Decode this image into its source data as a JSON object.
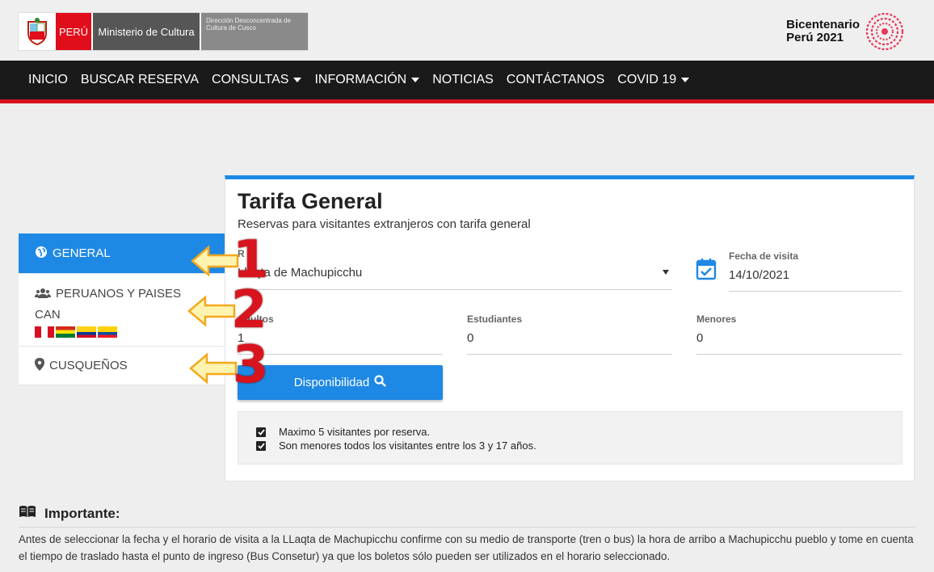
{
  "header": {
    "logo_peru": "PERÚ",
    "logo_ministerio": "Ministerio de Cultura",
    "logo_direccion": "Dirección Desconcentrada de Cultura de Cusco",
    "bicentenario_line1": "Bicentenario",
    "bicentenario_line2": "Perú 2021"
  },
  "nav": {
    "items": [
      {
        "label": "INICIO",
        "dropdown": false
      },
      {
        "label": "BUSCAR RESERVA",
        "dropdown": false
      },
      {
        "label": "CONSULTAS",
        "dropdown": true
      },
      {
        "label": "INFORMACIÓN",
        "dropdown": true
      },
      {
        "label": "NOTICIAS",
        "dropdown": false
      },
      {
        "label": "CONTÁCTANOS",
        "dropdown": false
      },
      {
        "label": "COVID 19",
        "dropdown": true
      }
    ]
  },
  "tabs": {
    "general": "GENERAL",
    "peruanos": "PERUANOS Y PAISES CAN",
    "cusquenos": "CUSQUEÑOS"
  },
  "annotations": [
    "1",
    "2",
    "3"
  ],
  "card": {
    "title": "Tarifa General",
    "subtitle": "Reservas para visitantes extranjeros con tarifa general",
    "ruta_label": "R",
    "ruta_value": "Llaqta de Machupicchu",
    "fecha_label": "Fecha de visita",
    "fecha_value": "14/10/2021",
    "adultos_label": "Adultos",
    "adultos_value": "1",
    "estudiantes_label": "Estudiantes",
    "estudiantes_value": "0",
    "menores_label": "Menores",
    "menores_value": "0",
    "button_label": "Disponibilidad",
    "notes": [
      "Maximo 5 visitantes por reserva.",
      "Son menores todos los visitantes entre los 3 y 17 años."
    ]
  },
  "importante": {
    "title": "Importante:",
    "text": "Antes de seleccionar la fecha y el horario de visita a la LLaqta de Machupicchu confirme con su medio de transporte (tren o bus) la hora de arribo a Machupicchu pueblo y tome en cuenta el tiempo de traslado hasta el punto de ingreso (Bus Consetur) ya que los boletos sólo pueden ser utilizados en el horario seleccionado."
  },
  "colors": {
    "primary": "#1e88e5",
    "navbar": "#1a1a1a",
    "accent_red": "#d7121d"
  }
}
